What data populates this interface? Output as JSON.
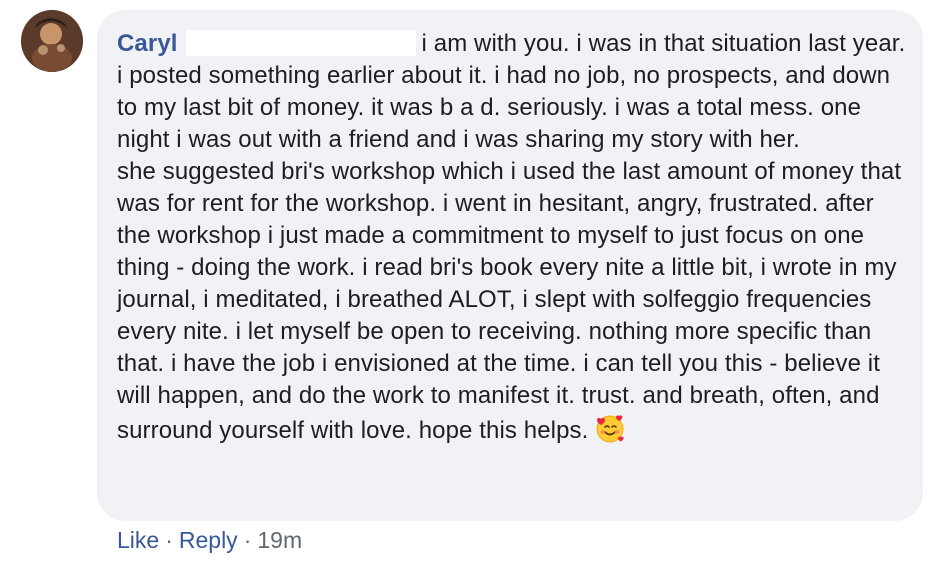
{
  "comment": {
    "author": "Caryl",
    "line_1": "i am with you. i was in that situation last year. i posted something earlier about it. i had no job, no prospects, and down to my last bit of money. it was b a d. seriously. i was a total mess. one night i was out with a friend and i was sharing my story with her.",
    "line_2": "she suggested bri's workshop which i used the last amount of money that was for rent for the workshop. i went in hesitant, angry, frustrated. after the workshop i just made a commitment to myself to just focus on one thing - doing the work. i read bri's book every nite a little bit, i wrote in my journal, i meditated, i breathed ALOT, i slept with solfeggio frequencies every nite. i let myself be open to receiving. nothing more specific than that. i have the job i envisioned at the time. i can tell you this - believe it will happen, and do the work to manifest it. trust. and breath, often, and surround yourself with love. hope this helps.",
    "emoji": "smiling-face-with-hearts-icon"
  },
  "actions": {
    "like_label": "Like",
    "separator": "·",
    "reply_label": "Reply",
    "timestamp": "19m"
  },
  "colors": {
    "author": "#385898",
    "bubble": "#f0f2f5",
    "text": "#1c1e21",
    "meta": "#606770"
  }
}
